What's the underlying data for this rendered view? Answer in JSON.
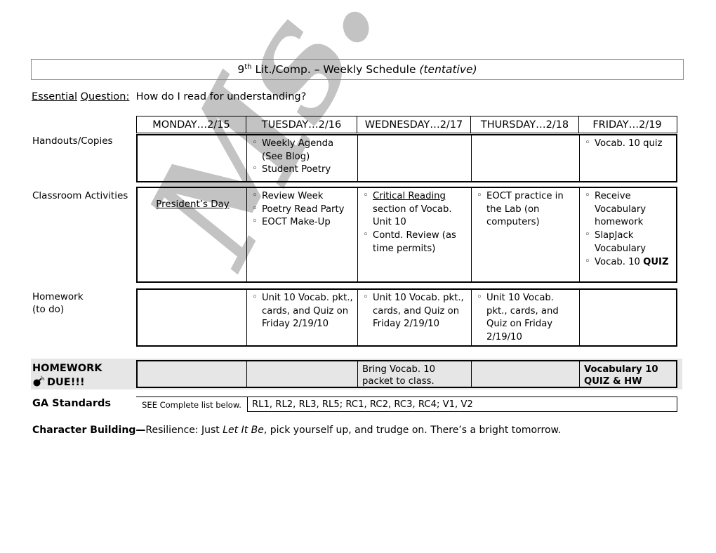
{
  "document": {
    "title_prefix": "9",
    "title_sup": "th",
    "title_main": " Lit./Comp. – Weekly Schedule ",
    "title_italic": "(tentative)",
    "watermark_text": "Ms. Evans",
    "watermark_color": "#c3c3c3",
    "shade_color": "#e6e6e6"
  },
  "essential_question": {
    "label_part1": "Essential",
    "label_part2": "Question:",
    "text": "How do I read for understanding?"
  },
  "table": {
    "day_headers": [
      "MONDAY…2/15",
      "TUESDAY…2/16",
      "WEDNESDAY…2/17",
      "THURSDAY…2/18",
      "FRIDAY…2/19"
    ],
    "rows": [
      {
        "label": "Handouts/Copies",
        "cells": [
          {
            "items": []
          },
          {
            "items": [
              {
                "text": "Weekly Agenda (See Blog)"
              },
              {
                "text": "Student Poetry"
              }
            ]
          },
          {
            "items": []
          },
          {
            "items": []
          },
          {
            "items": [
              {
                "text": "Vocab. 10 quiz"
              }
            ]
          }
        ]
      },
      {
        "label": "Classroom Activities",
        "cells": [
          {
            "plain_underlined": "President’s Day",
            "items": []
          },
          {
            "items": [
              {
                "text": "Review Week"
              },
              {
                "text": "Poetry Read Party"
              },
              {
                "text": "EOCT Make-Up"
              }
            ]
          },
          {
            "items": [
              {
                "underline_lead": "Critical Reading",
                "text": " section of Vocab. Unit 10"
              },
              {
                "text": "Contd. Review (as time permits)"
              }
            ]
          },
          {
            "items": [
              {
                "text": "EOCT practice in the Lab (on computers)"
              }
            ]
          },
          {
            "items": [
              {
                "text": "Receive Vocabulary homework"
              },
              {
                "text": "SlapJack Vocabulary"
              },
              {
                "text": "Vocab. 10 ",
                "bold_tail": "QUIZ"
              }
            ]
          }
        ]
      },
      {
        "label": "Homework\n(to do)",
        "label_line1": "Homework",
        "label_line2": "(to do)",
        "cells": [
          {
            "items": []
          },
          {
            "items": [
              {
                "text": "Unit 10 Vocab. pkt., cards, and Quiz on Friday 2/19/10"
              }
            ]
          },
          {
            "items": [
              {
                "text": "Unit 10 Vocab. pkt., cards, and Quiz on Friday 2/19/10"
              }
            ]
          },
          {
            "items": [
              {
                "text": "Unit 10 Vocab. pkt., cards, and Quiz on Friday 2/19/10"
              }
            ]
          },
          {
            "items": []
          }
        ]
      }
    ],
    "homework_due": {
      "label_line1": "HOMEWORK",
      "label_line2": "DUE!!!",
      "icon": "bomb-icon",
      "cells": [
        {
          "text": ""
        },
        {
          "text": ""
        },
        {
          "text": "Bring Vocab. 10 packet to class.",
          "bold": false
        },
        {
          "text": ""
        },
        {
          "text": "Vocabulary 10 QUIZ & HW",
          "bold": true
        }
      ]
    },
    "ga_standards": {
      "label": "GA Standards",
      "see_note": "SEE Complete list below.",
      "list": "RL1, RL2, RL3, RL5; RC1, RC2, RC3, RC4; V1, V2"
    }
  },
  "character_building": {
    "label": "Character Building—",
    "text_part1": "Resilience:  Just ",
    "italic_title": "Let It Be",
    "text_part2": ", pick yourself up, and trudge on.  There’s a bright tomorrow."
  }
}
